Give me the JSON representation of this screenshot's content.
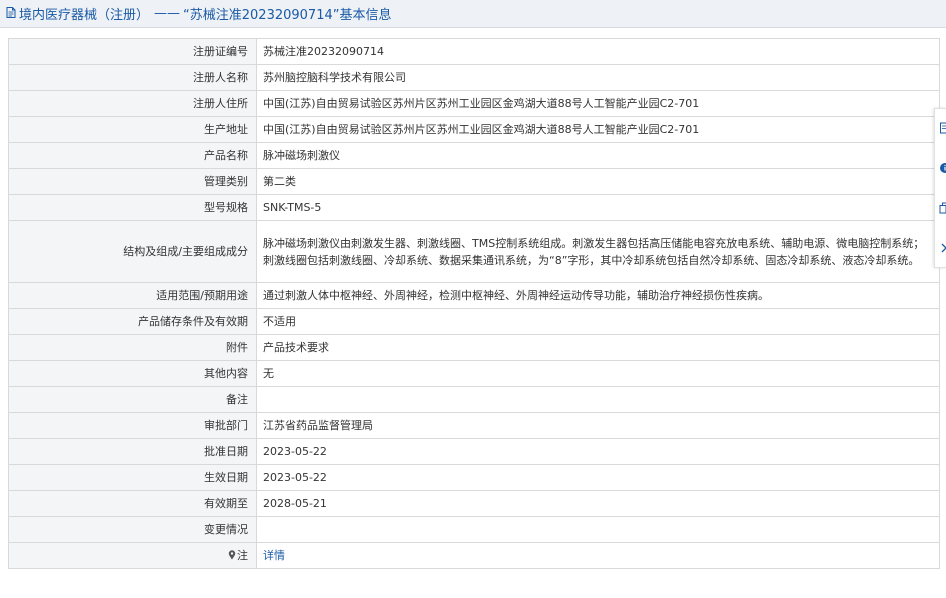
{
  "header": {
    "title_main": "境内医疗器械（注册）",
    "title_sep": "——",
    "title_regno": "“苏械注准20232090714”",
    "title_suffix": "基本信息"
  },
  "rows": [
    {
      "label": "注册证编号",
      "value": "苏械注准20232090714"
    },
    {
      "label": "注册人名称",
      "value": "苏州脑控脑科学技术有限公司"
    },
    {
      "label": "注册人住所",
      "value": "中国(江苏)自由贸易试验区苏州片区苏州工业园区金鸡湖大道88号人工智能产业园C2-701"
    },
    {
      "label": "生产地址",
      "value": "中国(江苏)自由贸易试验区苏州片区苏州工业园区金鸡湖大道88号人工智能产业园C2-701"
    },
    {
      "label": "产品名称",
      "value": "脉冲磁场刺激仪"
    },
    {
      "label": "管理类别",
      "value": "第二类"
    },
    {
      "label": "型号规格",
      "value": "SNK-TMS-5"
    },
    {
      "label": "结构及组成/主要组成成分",
      "value": "脉冲磁场刺激仪由刺激发生器、刺激线圈、TMS控制系统组成。刺激发生器包括高压储能电容充放电系统、辅助电源、微电脑控制系统；刺激线圈包括刺激线圈、冷却系统、数据采集通讯系统，为“8”字形，其中冷却系统包括自然冷却系统、固态冷却系统、液态冷却系统。"
    },
    {
      "label": "适用范围/预期用途",
      "value": "通过刺激人体中枢神经、外周神经，检测中枢神经、外周神经运动传导功能，辅助治疗神经损伤性疾病。"
    },
    {
      "label": "产品储存条件及有效期",
      "value": "不适用"
    },
    {
      "label": "附件",
      "value": "产品技术要求"
    },
    {
      "label": "其他内容",
      "value": "无"
    },
    {
      "label": "备注",
      "value": ""
    },
    {
      "label": "审批部门",
      "value": "江苏省药品监督管理局"
    },
    {
      "label": "批准日期",
      "value": "2023-05-22"
    },
    {
      "label": "生效日期",
      "value": "2023-05-22"
    },
    {
      "label": "有效期至",
      "value": "2028-05-21"
    },
    {
      "label": "变更情况",
      "value": ""
    }
  ],
  "note_row": {
    "label": "注",
    "link_text": "详情"
  },
  "icons": {
    "header_icon": "document-icon",
    "note_icon": "pin-icon",
    "side": [
      "document-icon",
      "info-icon",
      "copy-icon",
      "chevron-right-icon"
    ]
  },
  "colors": {
    "link": "#1a5aa6",
    "label_bg": "#f4f5f7",
    "header_bg": "#eef1f5",
    "border": "#d9d9d9"
  }
}
